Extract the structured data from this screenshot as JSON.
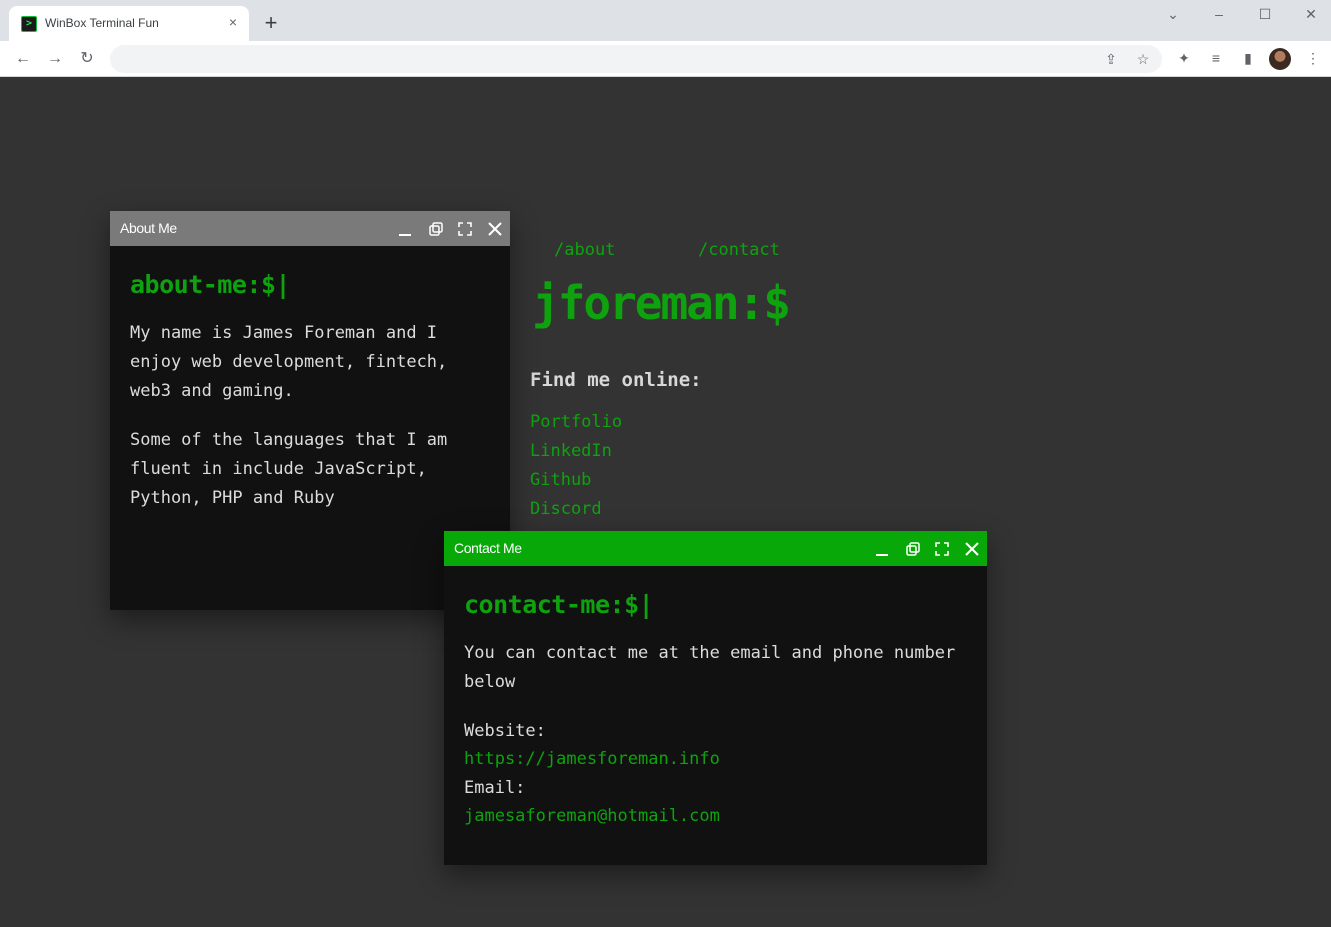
{
  "browser": {
    "tab_title": "WinBox Terminal Fun",
    "tab_close_icon": "×",
    "new_tab_icon": "+",
    "window_controls": {
      "dropdown": "⌄",
      "minimize": "–",
      "maximize": "☐",
      "close": "✕"
    },
    "nav": {
      "back": "←",
      "forward": "→",
      "reload": "↻"
    },
    "omnibox_icons": {
      "share": "⇪",
      "bookmark": "☆",
      "extensions": "✦",
      "media": "≡",
      "side_panel": "▮",
      "menu": "⋮"
    }
  },
  "page": {
    "nav_links": [
      "/about",
      "/contact"
    ],
    "brand": "jforeman:$",
    "find_title": "Find me online:",
    "social_links": [
      "Portfolio",
      "LinkedIn",
      "Github",
      "Discord"
    ]
  },
  "about_window": {
    "title": "About Me",
    "prompt": "about-me:$|",
    "paragraphs": [
      "My name is James Foreman and I enjoy web development, fintech, web3 and gaming.",
      "Some of the languages that I am fluent in include JavaScript, Python, PHP and Ruby"
    ]
  },
  "contact_window": {
    "title": "Contact Me",
    "prompt": "contact-me:$|",
    "intro": "You can contact me at the email and phone number below",
    "website_label": "Website:",
    "website": "https://jamesforeman.info",
    "email_label": "Email:",
    "email": "jamesaforeman@hotmail.com"
  },
  "colors": {
    "page_bg": "#333333",
    "accent_green": "#0ea30e",
    "contact_header": "#08a808",
    "about_header": "#7a7a7a",
    "window_bg": "#111111"
  },
  "icons": {
    "tab_favicon": "terminal-icon",
    "window_buttons": [
      "minimize-icon",
      "restore-icon",
      "fullscreen-icon",
      "close-icon"
    ]
  }
}
